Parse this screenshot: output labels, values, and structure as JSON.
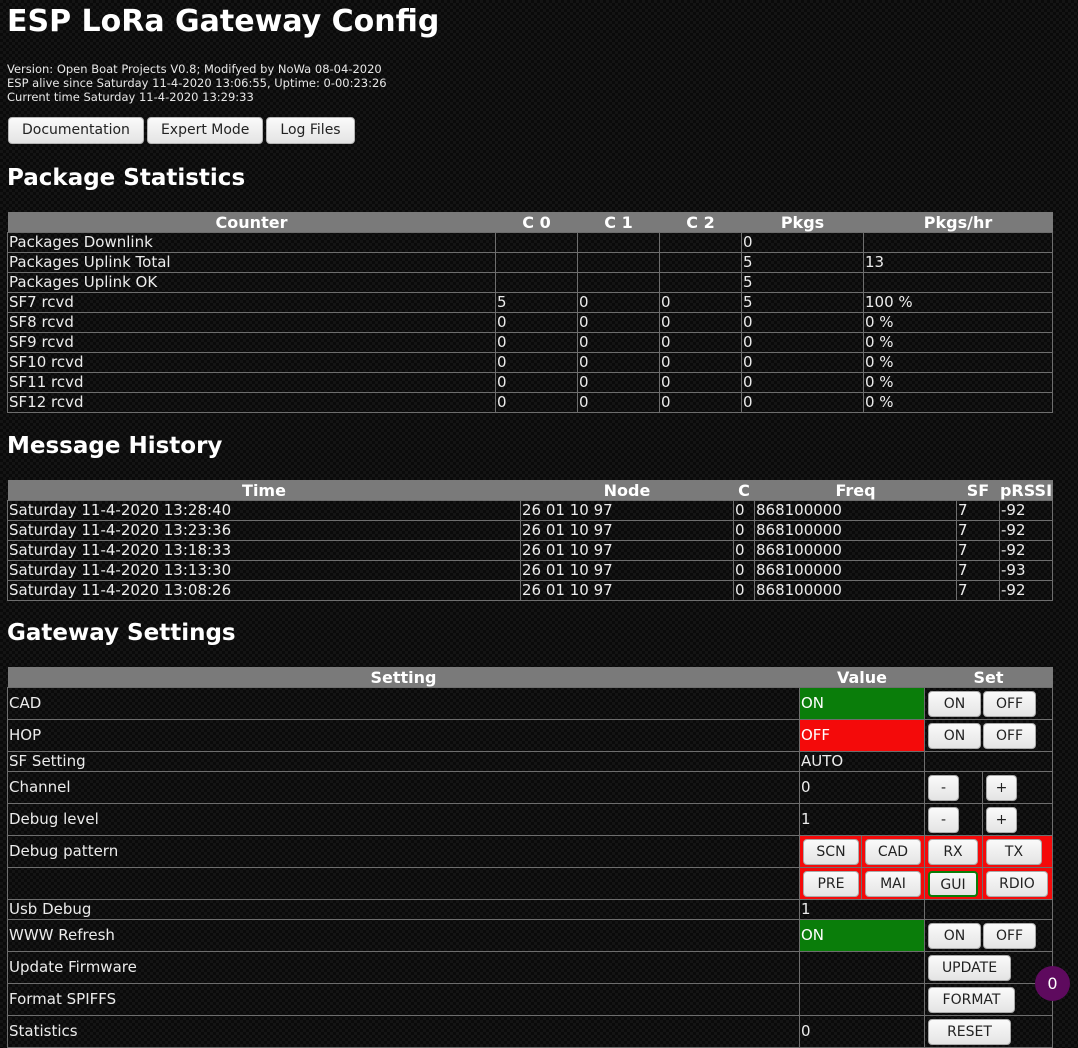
{
  "title": "ESP LoRa Gateway Config",
  "info": {
    "version": "Version: Open Boat Projects V0.8; Modifyed by NoWa 08-04-2020",
    "alive": "ESP alive since Saturday 11-4-2020 13:06:55, Uptime: 0-00:23:26",
    "current": "Current time Saturday 11-4-2020 13:29:33"
  },
  "top_buttons": {
    "documentation": "Documentation",
    "expert": "Expert Mode",
    "logs": "Log Files"
  },
  "package_stats": {
    "heading": "Package Statistics",
    "headers": [
      "Counter",
      "C 0",
      "C 1",
      "C 2",
      "Pkgs",
      "Pkgs/hr"
    ],
    "rows": [
      [
        "Packages Downlink",
        "",
        "",
        "",
        "0",
        ""
      ],
      [
        "Packages Uplink Total",
        "",
        "",
        "",
        "5",
        "13"
      ],
      [
        "Packages Uplink OK",
        "",
        "",
        "",
        "5",
        ""
      ],
      [
        "SF7 rcvd",
        "5",
        "0",
        "0",
        "5",
        "100 %"
      ],
      [
        "SF8 rcvd",
        "0",
        "0",
        "0",
        "0",
        "0 %"
      ],
      [
        "SF9 rcvd",
        "0",
        "0",
        "0",
        "0",
        "0 %"
      ],
      [
        "SF10 rcvd",
        "0",
        "0",
        "0",
        "0",
        "0 %"
      ],
      [
        "SF11 rcvd",
        "0",
        "0",
        "0",
        "0",
        "0 %"
      ],
      [
        "SF12 rcvd",
        "0",
        "0",
        "0",
        "0",
        "0 %"
      ]
    ]
  },
  "message_history": {
    "heading": "Message History",
    "headers": [
      "Time",
      "Node",
      "C",
      "Freq",
      "SF",
      "pRSSI"
    ],
    "rows": [
      [
        "Saturday 11-4-2020 13:28:40",
        "26 01 10 97",
        "0",
        "868100000",
        "7",
        "-92"
      ],
      [
        "Saturday 11-4-2020 13:23:36",
        "26 01 10 97",
        "0",
        "868100000",
        "7",
        "-92"
      ],
      [
        "Saturday 11-4-2020 13:18:33",
        "26 01 10 97",
        "0",
        "868100000",
        "7",
        "-92"
      ],
      [
        "Saturday 11-4-2020 13:13:30",
        "26 01 10 97",
        "0",
        "868100000",
        "7",
        "-93"
      ],
      [
        "Saturday 11-4-2020 13:08:26",
        "26 01 10 97",
        "0",
        "868100000",
        "7",
        "-92"
      ]
    ]
  },
  "gateway_settings": {
    "heading": "Gateway Settings",
    "headers": [
      "Setting",
      "Value",
      "Set"
    ],
    "cad": {
      "label": "CAD",
      "value": "ON",
      "on": "ON",
      "off": "OFF"
    },
    "hop": {
      "label": "HOP",
      "value": "OFF",
      "on": "ON",
      "off": "OFF"
    },
    "sf": {
      "label": "SF Setting",
      "value": "AUTO"
    },
    "channel": {
      "label": "Channel",
      "value": "0",
      "minus": "-",
      "plus": "+"
    },
    "debug_level": {
      "label": "Debug level",
      "value": "1",
      "minus": "-",
      "plus": "+"
    },
    "debug_pattern": {
      "label": "Debug pattern",
      "row1": [
        "SCN",
        "CAD",
        "RX",
        "TX"
      ],
      "row2": [
        "PRE",
        "MAI",
        "GUI",
        "RDIO"
      ]
    },
    "usb_debug": {
      "label": "Usb Debug",
      "value": "1"
    },
    "www_refresh": {
      "label": "WWW Refresh",
      "value": "ON",
      "on": "ON",
      "off": "OFF"
    },
    "update_fw": {
      "label": "Update Firmware",
      "button": "UPDATE"
    },
    "format": {
      "label": "Format SPIFFS",
      "button": "FORMAT"
    },
    "statistics": {
      "label": "Statistics",
      "value": "0",
      "button": "RESET"
    }
  },
  "badge": "0"
}
